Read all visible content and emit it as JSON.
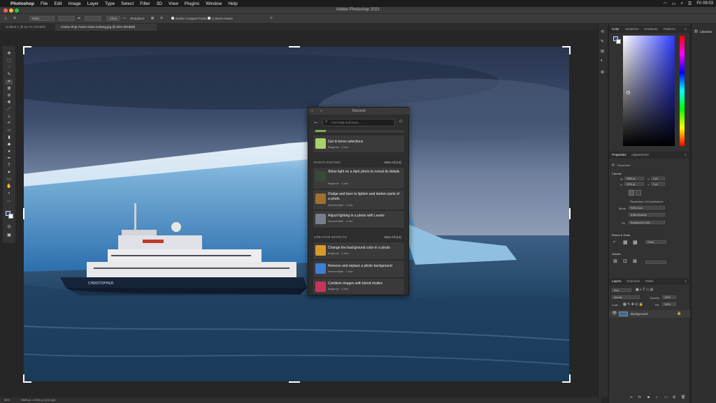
{
  "menubar": {
    "apple": "",
    "app": "Photoshop",
    "items": [
      "File",
      "Edit",
      "Image",
      "Layer",
      "Type",
      "Select",
      "Filter",
      "3D",
      "View",
      "Plugins",
      "Window",
      "Help"
    ],
    "clock": "Fri 09:03"
  },
  "window": {
    "title": "Adobe Photoshop 2021"
  },
  "options": {
    "ratio": "Ratio",
    "clear": "Clear",
    "straighten": "Straighten",
    "delete_cropped": "Delete Cropped Pixels",
    "content_aware": "Content-Aware"
  },
  "tabs": [
    {
      "label": "Untitled-1 @ 66.7% (RGB/8)"
    },
    {
      "label": "Cruise Ship Faces Giant Iceberg.jpg @ 50% (RGB/8)"
    }
  ],
  "status": {
    "zoom": "50%",
    "info": "3886 px x 2393 px (240 ppi)"
  },
  "color_panel": {
    "tabs": [
      "Color",
      "Swatches",
      "Gradients",
      "Patterns"
    ]
  },
  "libraries": {
    "label": "Libraries"
  },
  "properties": {
    "tabs": [
      "Properties",
      "Adjustments"
    ],
    "document": "Document",
    "canvas": "Canvas",
    "w": "3886 px",
    "h": "2393 px",
    "x": "0 px",
    "y": "0 px",
    "resolution": "Resolution: 240 pixels/inch",
    "mode_label": "Mode",
    "mode": "RGB Color",
    "depth": "8 Bits/Channel",
    "fill_label": "Fill",
    "fill": "Background Color",
    "rulers": "Rulers & Grids",
    "units": "Pixels",
    "guides": "Guides"
  },
  "layers": {
    "tabs": [
      "Layers",
      "Channels",
      "Paths"
    ],
    "kind": "Kind",
    "blend": "Normal",
    "opacity_label": "Opacity:",
    "opacity": "100%",
    "lock_label": "Lock:",
    "fill_label": "Fill:",
    "fill": "100%",
    "background": "Background"
  },
  "discover": {
    "title": "Discover",
    "search_placeholder": "Find help and learn...",
    "top_card": {
      "title": "Get to know selections",
      "meta": "Beginner · 4 min"
    },
    "sections": [
      {
        "name": "PHOTO EDITING",
        "view_all": "View All (13)",
        "cards": [
          {
            "title": "Shine light on a dark photo to reveal its details",
            "meta": "Beginner · 5 min"
          },
          {
            "title": "Dodge and burn to lighten and darken parts of a photo",
            "meta": "Intermediate · 4 min"
          },
          {
            "title": "Adjust lighting in a photo with Levels",
            "meta": "Intermediate · 4 min"
          }
        ]
      },
      {
        "name": "CREATIVE EFFECTS",
        "view_all": "View All (12)",
        "cards": [
          {
            "title": "Change the background color in a photo",
            "meta": "Beginner · 3 min"
          },
          {
            "title": "Remove and replace a photo background",
            "meta": "Intermediate · 1 min"
          },
          {
            "title": "Combine images with blend modes",
            "meta": "Beginner · 4 min"
          }
        ]
      }
    ]
  },
  "ship": {
    "name": "CHRISTOPHER"
  },
  "colors": {
    "accent": "#2d8ceb",
    "panel": "#323232"
  }
}
